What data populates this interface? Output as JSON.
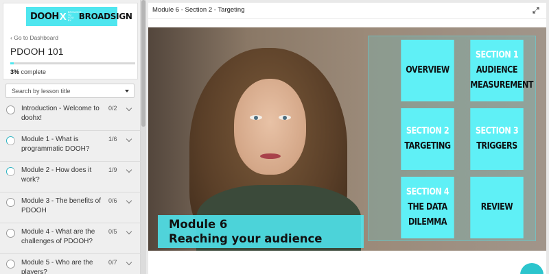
{
  "sidebar": {
    "logo": {
      "left": "DOOH",
      "x": "X",
      "small": "BROUGHT TO YOU BY",
      "right": "BROADSIGN"
    },
    "back_link": "Go to Dashboard",
    "course_title": "PDOOH 101",
    "progress": {
      "percent_label": "3%",
      "suffix": "complete",
      "value": 0.03
    },
    "search_placeholder": "Search by lesson title",
    "lessons": [
      {
        "title": "Introduction - Welcome to doohx!",
        "count": "0/2",
        "status": "empty"
      },
      {
        "title": "Module 1 - What is programmatic DOOH?",
        "count": "1/6",
        "status": "partial"
      },
      {
        "title": "Module 2 - How does it work?",
        "count": "1/9",
        "status": "partial"
      },
      {
        "title": "Module 3 - The benefits of PDOOH",
        "count": "0/6",
        "status": "empty"
      },
      {
        "title": "Module 4 - What are the challenges of PDOOH?",
        "count": "0/5",
        "status": "empty"
      },
      {
        "title": "Module 5 - Who are the players?",
        "count": "0/7",
        "status": "empty"
      }
    ]
  },
  "header": {
    "breadcrumb": "Module 6 - Section 2 - Targeting"
  },
  "video": {
    "tiles": [
      {
        "label_sec": "",
        "label": "OVERVIEW"
      },
      {
        "label_sec": "SECTION 1",
        "label": "AUDIENCE MEASUREMENT"
      },
      {
        "label_sec": "SECTION 2",
        "label": "TARGETING"
      },
      {
        "label_sec": "SECTION 3",
        "label": "TRIGGERS"
      },
      {
        "label_sec": "SECTION 4",
        "label": "THE DATA DILEMMA"
      },
      {
        "label_sec": "",
        "label": "REVIEW"
      }
    ],
    "caption_line1": "Module 6",
    "caption_line2": "Reaching your audience"
  },
  "colors": {
    "accent": "#4fe6ef",
    "tile": "#5ff0f6"
  }
}
